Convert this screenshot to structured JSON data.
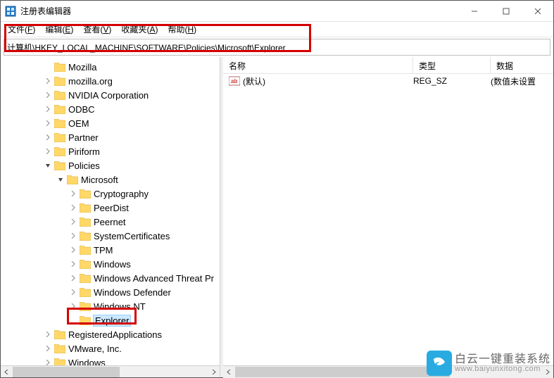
{
  "window": {
    "title": "注册表编辑器"
  },
  "menu": {
    "file": "文件",
    "file_hk": "F",
    "edit": "编辑",
    "edit_hk": "E",
    "view": "查看",
    "view_hk": "V",
    "fav": "收藏夹",
    "fav_hk": "A",
    "help": "帮助",
    "help_hk": "H"
  },
  "address": {
    "path": "计算机\\HKEY_LOCAL_MACHINE\\SOFTWARE\\Policies\\Microsoft\\Explorer"
  },
  "tree": [
    {
      "indent": 3,
      "exp": "none",
      "label": "Mozilla"
    },
    {
      "indent": 3,
      "exp": "closed",
      "label": "mozilla.org"
    },
    {
      "indent": 3,
      "exp": "closed",
      "label": "NVIDIA Corporation"
    },
    {
      "indent": 3,
      "exp": "closed",
      "label": "ODBC"
    },
    {
      "indent": 3,
      "exp": "closed",
      "label": "OEM"
    },
    {
      "indent": 3,
      "exp": "closed",
      "label": "Partner"
    },
    {
      "indent": 3,
      "exp": "closed",
      "label": "Piriform"
    },
    {
      "indent": 3,
      "exp": "open",
      "label": "Policies"
    },
    {
      "indent": 4,
      "exp": "open",
      "label": "Microsoft"
    },
    {
      "indent": 5,
      "exp": "closed",
      "label": "Cryptography"
    },
    {
      "indent": 5,
      "exp": "closed",
      "label": "PeerDist"
    },
    {
      "indent": 5,
      "exp": "closed",
      "label": "Peernet"
    },
    {
      "indent": 5,
      "exp": "closed",
      "label": "SystemCertificates"
    },
    {
      "indent": 5,
      "exp": "closed",
      "label": "TPM"
    },
    {
      "indent": 5,
      "exp": "closed",
      "label": "Windows"
    },
    {
      "indent": 5,
      "exp": "closed",
      "label": "Windows Advanced Threat Pr"
    },
    {
      "indent": 5,
      "exp": "closed",
      "label": "Windows Defender"
    },
    {
      "indent": 5,
      "exp": "closed",
      "label": "Windows NT"
    },
    {
      "indent": 5,
      "exp": "none",
      "label": "Explorer",
      "selected": true
    },
    {
      "indent": 3,
      "exp": "closed",
      "label": "RegisteredApplications"
    },
    {
      "indent": 3,
      "exp": "closed",
      "label": "VMware, Inc."
    },
    {
      "indent": 3,
      "exp": "closed",
      "label": "Windows"
    }
  ],
  "list": {
    "headers": {
      "name": "名称",
      "type": "类型",
      "data": "数据"
    },
    "rows": [
      {
        "name": "(默认)",
        "type": "REG_SZ",
        "data": "(数值未设置"
      }
    ]
  },
  "watermark": {
    "cn": "白云一键重装系统",
    "url": "www.baiyunxitong.com"
  }
}
